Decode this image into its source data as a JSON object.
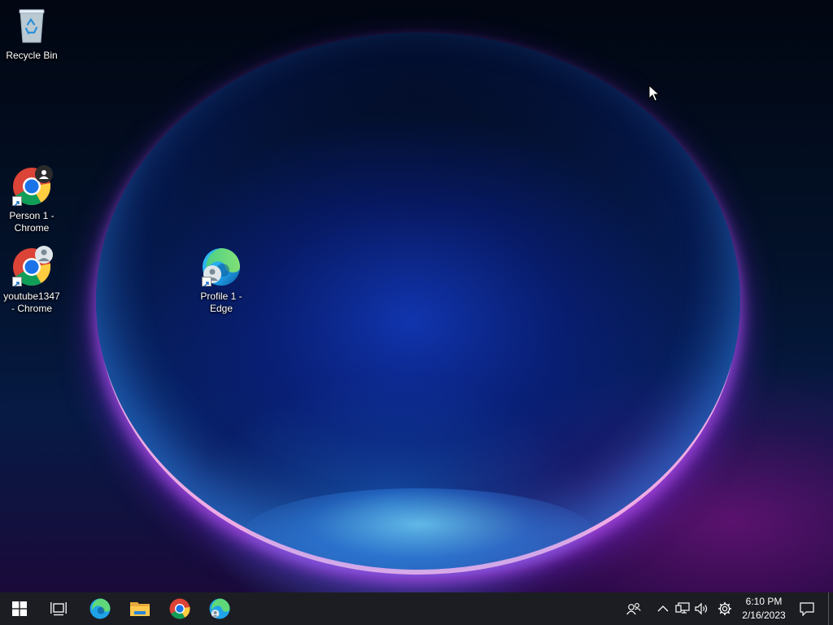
{
  "desktop": {
    "icons": [
      {
        "label": "Recycle Bin",
        "icon": "recycle-bin-icon"
      },
      {
        "label": "Person 1 - Chrome",
        "icon": "chrome-icon",
        "badge": "person-icon"
      },
      {
        "label": "youtube1347 - Chrome",
        "icon": "chrome-icon",
        "badge": "avatar-icon"
      },
      {
        "label": "Profile 1 - Edge",
        "icon": "edge-icon",
        "badge": "avatar-icon"
      }
    ]
  },
  "taskbar": {
    "pinned": [
      {
        "name": "start-button",
        "icon": "windows-icon"
      },
      {
        "name": "task-view-button",
        "icon": "task-view-icon"
      },
      {
        "name": "edge-taskbar-button",
        "icon": "edge-icon"
      },
      {
        "name": "file-explorer-button",
        "icon": "folder-icon"
      },
      {
        "name": "chrome-taskbar-button",
        "icon": "chrome-icon"
      },
      {
        "name": "edge-profile-taskbar-button",
        "icon": "edge-icon"
      }
    ],
    "tray": {
      "time": "6:10 PM",
      "date": "2/16/2023",
      "icons": [
        "people-icon",
        "chevron-up-icon",
        "network-icon",
        "volume-icon",
        "gear-icon",
        "notification-icon"
      ]
    }
  },
  "colors": {
    "taskbar_bg": "#1c1d22",
    "accent_blue": "#1a73e8"
  }
}
